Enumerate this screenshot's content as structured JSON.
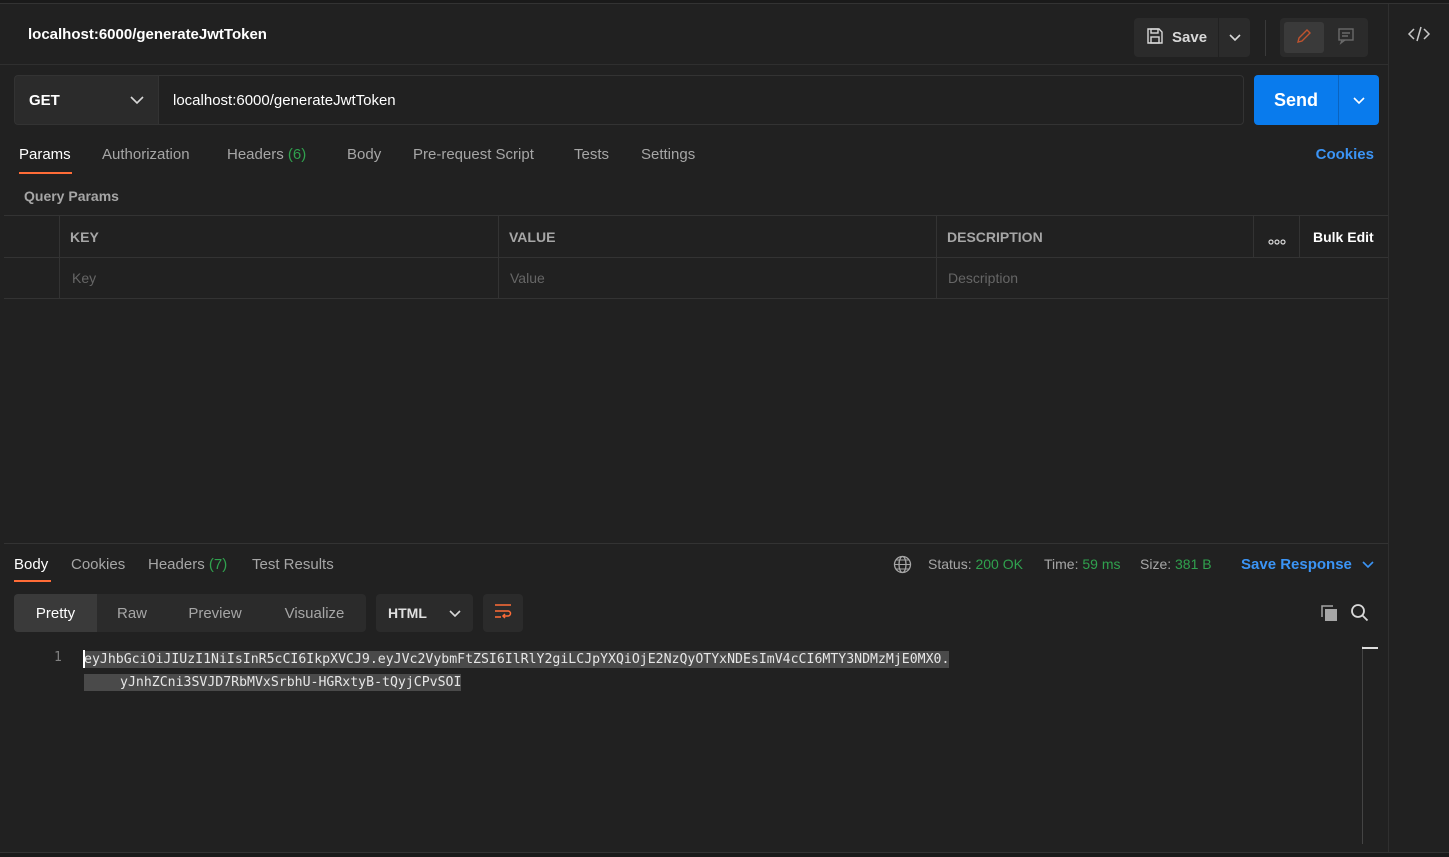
{
  "header": {
    "title": "localhost:6000/generateJwtToken",
    "save_label": "Save"
  },
  "request": {
    "method": "GET",
    "url": "localhost:6000/generateJwtToken",
    "send_label": "Send"
  },
  "tabs": {
    "params": "Params",
    "authorization": "Authorization",
    "headers": "Headers",
    "headers_count": "(6)",
    "body": "Body",
    "prerequest": "Pre-request Script",
    "tests": "Tests",
    "settings": "Settings",
    "cookies": "Cookies"
  },
  "query_params": {
    "title": "Query Params",
    "columns": [
      "KEY",
      "VALUE",
      "DESCRIPTION"
    ],
    "bulk_edit": "Bulk Edit",
    "more": "ooo",
    "placeholders": {
      "key": "Key",
      "value": "Value",
      "description": "Description"
    }
  },
  "response": {
    "tabs": {
      "body": "Body",
      "cookies": "Cookies",
      "headers": "Headers",
      "headers_count": "(7)",
      "test_results": "Test Results"
    },
    "status_label": "Status:",
    "status_value": "200 OK",
    "time_label": "Time:",
    "time_value": "59 ms",
    "size_label": "Size:",
    "size_value": "381 B",
    "save_response": "Save Response",
    "views": [
      "Pretty",
      "Raw",
      "Preview",
      "Visualize"
    ],
    "format": "HTML",
    "line_number": "1",
    "body_line1": "eyJhbGciOiJIUzI1NiIsInR5cCI6IkpXVCJ9.eyJVc2VybmFtZSI6IlRlY2giLCJpYXQiOjE2NzQyOTYxNDEsImV4cCI6MTY3NDMzMjE0MX0.",
    "body_line2": "yJnhZCni3SVJD7RbMVxSrbhU-HGRxtyB-tQyjCPvSOI"
  },
  "colors": {
    "accent": "#ff6c37",
    "send": "#097bed",
    "link": "#3b94f5",
    "success": "#30a14e"
  }
}
